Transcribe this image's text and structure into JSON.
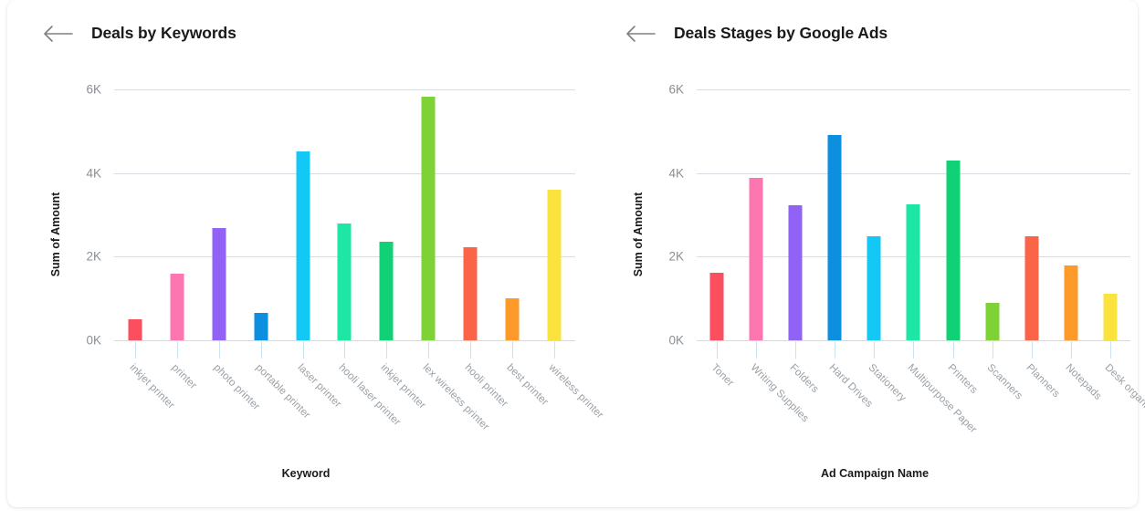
{
  "panels": [
    {
      "title": "Deals by Keywords",
      "back_icon": "arrow-left-icon",
      "chart_data": {
        "type": "bar",
        "title": "Deals by Keywords",
        "xlabel": "Keyword",
        "ylabel": "Sum of Amount",
        "ylim": [
          0,
          6000
        ],
        "yticks": [
          0,
          2000,
          4000,
          6000
        ],
        "ytick_labels": [
          "0K",
          "2K",
          "4K",
          "6K"
        ],
        "grid": true,
        "legend": "none",
        "categories": [
          "inkjet printer",
          "printer",
          "photo printer",
          "portable printer",
          "laser printer",
          "hooli laser printer",
          "inkjet printer",
          "lex wireless printer",
          "hooli printer",
          "best printer",
          "wireless printer"
        ],
        "values": [
          500,
          1600,
          2680,
          660,
          4520,
          2800,
          2350,
          5830,
          2230,
          1000,
          3600
        ],
        "colors": [
          "#fb4e5e",
          "#fd76b0",
          "#9063f6",
          "#0d8fe0",
          "#14c8f5",
          "#1ee6a4",
          "#11d176",
          "#7ed236",
          "#fa6548",
          "#fd9a2a",
          "#fae33c"
        ]
      }
    },
    {
      "title": "Deals Stages by Google Ads",
      "back_icon": "arrow-left-icon",
      "chart_data": {
        "type": "bar",
        "title": "Deals Stages by Google Ads",
        "xlabel": "Ad Campaign Name",
        "ylabel": "Sum of Amount",
        "ylim": [
          0,
          6000
        ],
        "yticks": [
          0,
          2000,
          4000,
          6000
        ],
        "ytick_labels": [
          "0K",
          "2K",
          "4K",
          "6K"
        ],
        "grid": true,
        "legend": "none",
        "categories": [
          "Toner",
          "Writing Supplies",
          "Folders",
          "Hard Drives",
          "Stationery",
          "Multipurpose Paper",
          "Printers",
          "Scanners",
          "Planners",
          "Notepads",
          "Desk organizers"
        ],
        "values": [
          1620,
          3880,
          3230,
          4920,
          2480,
          3250,
          4300,
          900,
          2480,
          1800,
          1120
        ],
        "colors": [
          "#fb4e5e",
          "#fd76b0",
          "#9063f6",
          "#0d8fe0",
          "#14c8f5",
          "#1ee6a4",
          "#11d176",
          "#7ed236",
          "#fa6548",
          "#fd9a2a",
          "#fae33c"
        ]
      }
    }
  ],
  "theme": {
    "card_bg": "#ffffff",
    "grid_color": "#d9dde1",
    "axis_color": "#c8dced",
    "tick_text": "#8a8f94",
    "label_text": "#9aa0a6",
    "title_text": "#1a1a1a"
  }
}
